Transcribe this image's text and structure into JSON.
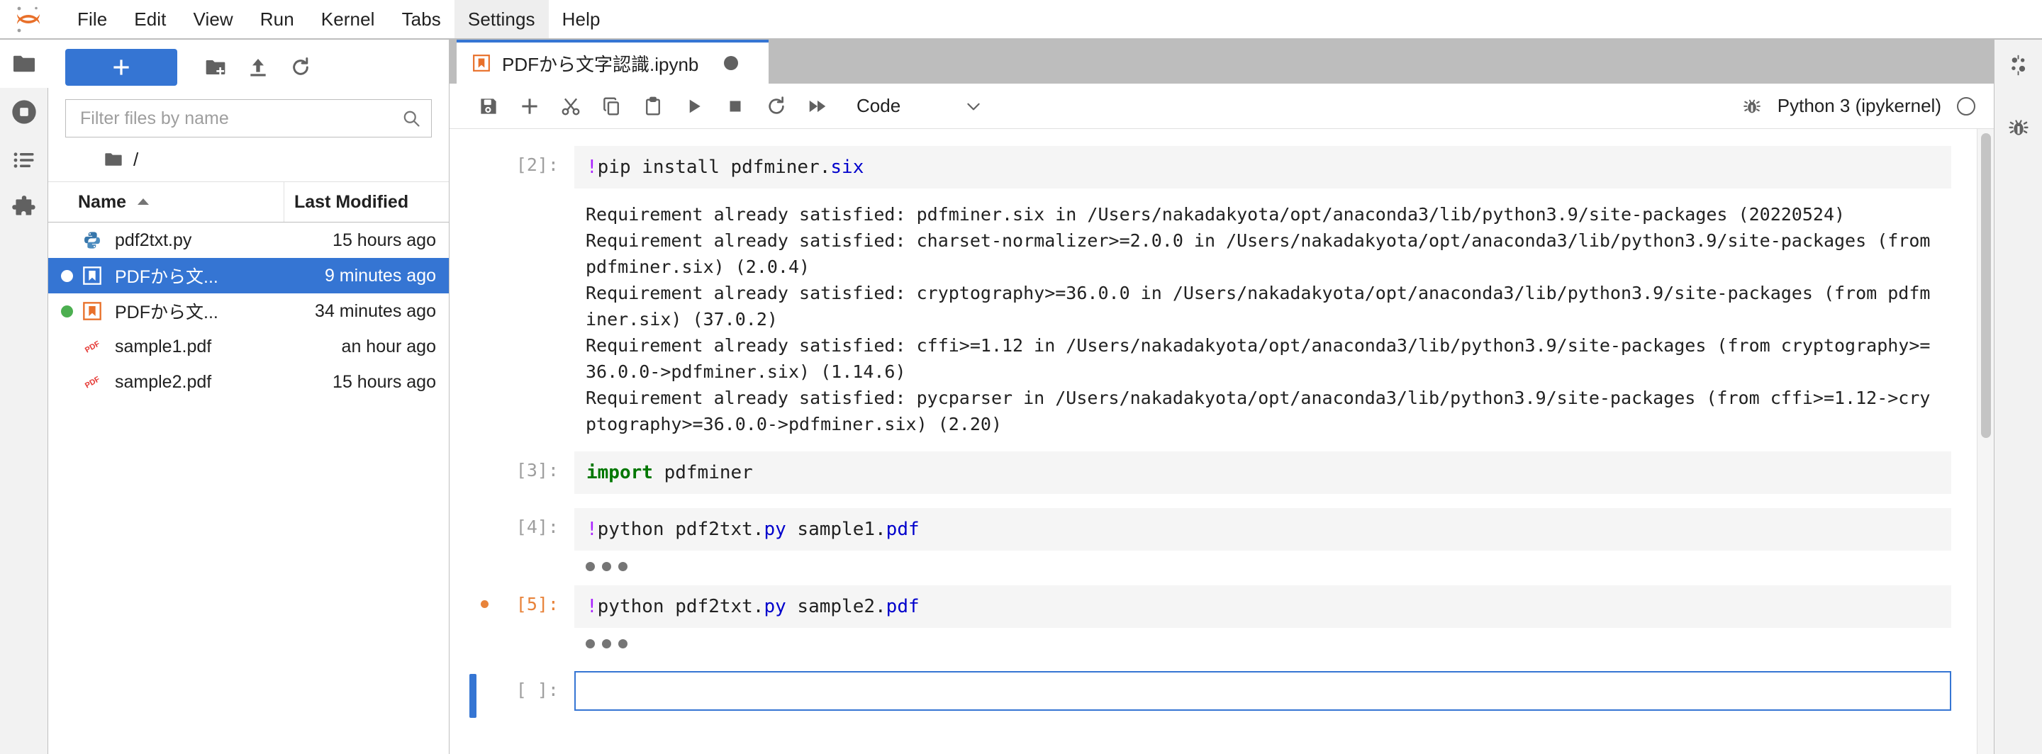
{
  "app": {
    "logo_icon": "jupyter-logo-icon"
  },
  "menubar": {
    "items": [
      {
        "label": "File",
        "name": "menu-file"
      },
      {
        "label": "Edit",
        "name": "menu-edit"
      },
      {
        "label": "View",
        "name": "menu-view"
      },
      {
        "label": "Run",
        "name": "menu-run"
      },
      {
        "label": "Kernel",
        "name": "menu-kernel"
      },
      {
        "label": "Tabs",
        "name": "menu-tabs"
      },
      {
        "label": "Settings",
        "name": "menu-settings"
      },
      {
        "label": "Help",
        "name": "menu-help"
      }
    ],
    "active_item": "Settings"
  },
  "activitybar": {
    "items": [
      {
        "name": "file-browser-icon",
        "title": "File Browser"
      },
      {
        "name": "running-sessions-icon",
        "title": "Running Terminals and Kernels"
      },
      {
        "name": "table-of-contents-icon",
        "title": "Table of Contents"
      },
      {
        "name": "extension-manager-icon",
        "title": "Extension Manager"
      }
    ]
  },
  "rightbar": {
    "items": [
      {
        "name": "property-inspector-icon",
        "title": "Property Inspector"
      },
      {
        "name": "debugger-icon",
        "title": "Debugger"
      }
    ]
  },
  "filebrowser": {
    "new_launcher_label": "+",
    "toolbar_icons": [
      {
        "name": "new-folder-icon",
        "title": "New Folder"
      },
      {
        "name": "upload-icon",
        "title": "Upload Files"
      },
      {
        "name": "refresh-icon",
        "title": "Refresh File List"
      }
    ],
    "filter": {
      "placeholder": "Filter files by name",
      "value": "",
      "icon": "search-icon"
    },
    "breadcrumb": {
      "home_icon": "folder-icon",
      "path": "/"
    },
    "columns": {
      "name": "Name",
      "last_modified": "Last Modified",
      "sort_icon": "sort-ascending-icon"
    },
    "rows": [
      {
        "name": "pdf2txt.py",
        "modified": "15 hours ago",
        "icon": "python-file-icon",
        "status": "none",
        "selected": false
      },
      {
        "name": "PDFから文...",
        "modified": "9 minutes ago",
        "icon": "notebook-file-icon",
        "status": "running-white",
        "selected": true
      },
      {
        "name": "PDFから文...",
        "modified": "34 minutes ago",
        "icon": "notebook-file-icon",
        "status": "running-green",
        "selected": false
      },
      {
        "name": "sample1.pdf",
        "modified": "an hour ago",
        "icon": "pdf-file-icon",
        "status": "none",
        "selected": false
      },
      {
        "name": "sample2.pdf",
        "modified": "15 hours ago",
        "icon": "pdf-file-icon",
        "status": "none",
        "selected": false
      }
    ]
  },
  "notebook": {
    "tab": {
      "title": "PDFから文字認識.ipynb",
      "icon": "notebook-file-icon",
      "dirty_indicator": "unsaved-changes-dot"
    },
    "toolbar": {
      "buttons": [
        {
          "name": "save-button",
          "icon": "save-icon",
          "title": "Save and create checkpoint"
        },
        {
          "name": "insert-cell-button",
          "icon": "plus-icon",
          "title": "Insert a cell below"
        },
        {
          "name": "cut-cells-button",
          "icon": "scissors-icon",
          "title": "Cut this cell"
        },
        {
          "name": "copy-cells-button",
          "icon": "copy-icon",
          "title": "Copy this cell"
        },
        {
          "name": "paste-cells-button",
          "icon": "paste-icon",
          "title": "Paste this cell from the clipboard"
        },
        {
          "name": "run-cell-button",
          "icon": "play-icon",
          "title": "Run the selected cells"
        },
        {
          "name": "interrupt-button",
          "icon": "stop-icon",
          "title": "Interrupt the kernel"
        },
        {
          "name": "restart-button",
          "icon": "restart-icon",
          "title": "Restart the kernel"
        },
        {
          "name": "restart-run-all-button",
          "icon": "fast-forward-icon",
          "title": "Restart the kernel and run all cells"
        }
      ],
      "cell_type": {
        "value": "Code",
        "chevron": "chevron-down-icon"
      },
      "debugger_icon": "bug-icon",
      "kernel_name": "Python 3 (ipykernel)",
      "kernel_status": "idle"
    },
    "cells": [
      {
        "prompt": "[2]:",
        "prompt_color": "gray",
        "collapse_dot": false,
        "active": false,
        "source_html": "<span style=\"color:#aa22ff\">!</span>pip install pdfminer.<span style=\"color:#0000cc\">six</span>",
        "source_text": "!pip install pdfminer.six",
        "output_type": "stream",
        "output_text": "Requirement already satisfied: pdfminer.six in /Users/nakadakyota/opt/anaconda3/lib/python3.9/site-packages (20220524)\nRequirement already satisfied: charset-normalizer>=2.0.0 in /Users/nakadakyota/opt/anaconda3/lib/python3.9/site-packages (from\npdfminer.six) (2.0.4)\nRequirement already satisfied: cryptography>=36.0.0 in /Users/nakadakyota/opt/anaconda3/lib/python3.9/site-packages (from pdfm\niner.six) (37.0.2)\nRequirement already satisfied: cffi>=1.12 in /Users/nakadakyota/opt/anaconda3/lib/python3.9/site-packages (from cryptography>=\n36.0.0->pdfminer.six) (1.14.6)\nRequirement already satisfied: pycparser in /Users/nakadakyota/opt/anaconda3/lib/python3.9/site-packages (from cffi>=1.12->cry\nptography>=36.0.0->pdfminer.six) (2.20)"
      },
      {
        "prompt": "[3]:",
        "prompt_color": "gray",
        "collapse_dot": false,
        "active": false,
        "source_html": "<span style=\"color:#007700;font-weight:bold\">import</span> pdfminer",
        "source_text": "import pdfminer",
        "output_type": "none",
        "output_text": ""
      },
      {
        "prompt": "[4]:",
        "prompt_color": "gray",
        "collapse_dot": false,
        "active": false,
        "source_html": "<span style=\"color:#aa22ff\">!</span>python pdf2txt.<span style=\"color:#0000cc\">py</span> sample1.<span style=\"color:#0000cc\">pdf</span>",
        "source_text": "!python pdf2txt.py sample1.pdf",
        "output_type": "collapsed",
        "output_text": ""
      },
      {
        "prompt": "[5]:",
        "prompt_color": "orange",
        "collapse_dot": true,
        "active": false,
        "source_html": "<span style=\"color:#aa22ff\">!</span>python pdf2txt.<span style=\"color:#0000cc\">py</span> sample2.<span style=\"color:#0000cc\">pdf</span>",
        "source_text": "!python pdf2txt.py sample2.pdf",
        "output_type": "collapsed",
        "output_text": ""
      },
      {
        "prompt": "[ ]:",
        "prompt_color": "gray",
        "collapse_dot": false,
        "active": true,
        "source_html": "",
        "source_text": "",
        "output_type": "none",
        "output_text": ""
      }
    ]
  },
  "colors": {
    "accent_blue": "#3575d3",
    "selection_blue": "#3575d3",
    "orange": "#e8833a",
    "green": "#4caf50",
    "chrome_gray": "#bdbdbd",
    "panel_gray": "#f2f2f2",
    "cell_input_gray": "#f5f5f5"
  }
}
